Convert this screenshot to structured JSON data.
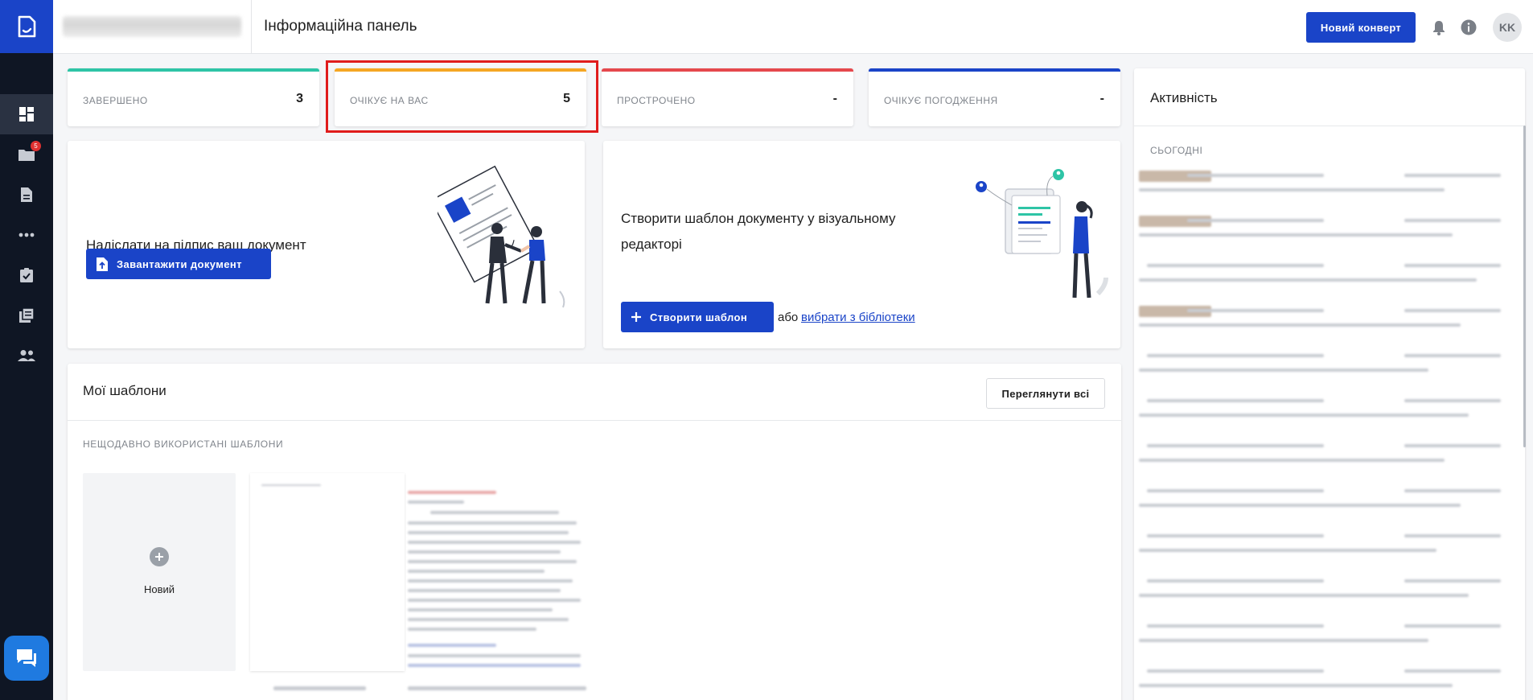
{
  "header": {
    "title": "Інформаційна панель",
    "new_envelope_label": "Новий конверт",
    "avatar_initials": "KK"
  },
  "sidebar": {
    "badge_count": "5",
    "items": [
      {
        "icon": "dashboard-icon",
        "active": true
      },
      {
        "icon": "folder-icon",
        "active": false
      },
      {
        "icon": "document-icon",
        "active": false
      },
      {
        "icon": "more-dots-icon",
        "active": false
      },
      {
        "icon": "clipboard-check-icon",
        "active": false
      },
      {
        "icon": "library-icon",
        "active": false
      },
      {
        "icon": "users-icon",
        "active": false
      }
    ]
  },
  "stats": [
    {
      "label": "ЗАВЕРШЕНО",
      "value": "3",
      "color": "#2ec4a6"
    },
    {
      "label": "ОЧІКУЄ НА ВАС",
      "value": "5",
      "color": "#f5a623"
    },
    {
      "label": "ПРОСТРОЧЕНО",
      "value": "-",
      "color": "#e5484d"
    },
    {
      "label": "ОЧІКУЄ ПОГОДЖЕННЯ",
      "value": "-",
      "color": "#1a44c8"
    }
  ],
  "send_card": {
    "text": "Надіслати на підпис ваш документ",
    "button_label": "Завантажити документ"
  },
  "template_card": {
    "text": "Створити шаблон документу у візуальному редакторі",
    "button_label": "Створити шаблон",
    "or_text": "або",
    "link_label": "вибрати з бібліотеки"
  },
  "templates": {
    "title": "Мої шаблони",
    "view_all_label": "Переглянути всі",
    "recent_label": "НЕЩОДАВНО ВИКОРИСТАНІ ШАБЛОНИ",
    "new_label": "Новий"
  },
  "activity": {
    "title": "Активність",
    "today_label": "СЬОГОДНІ"
  },
  "colors": {
    "primary": "#1a44c8",
    "sidebar": "#0f1624"
  }
}
